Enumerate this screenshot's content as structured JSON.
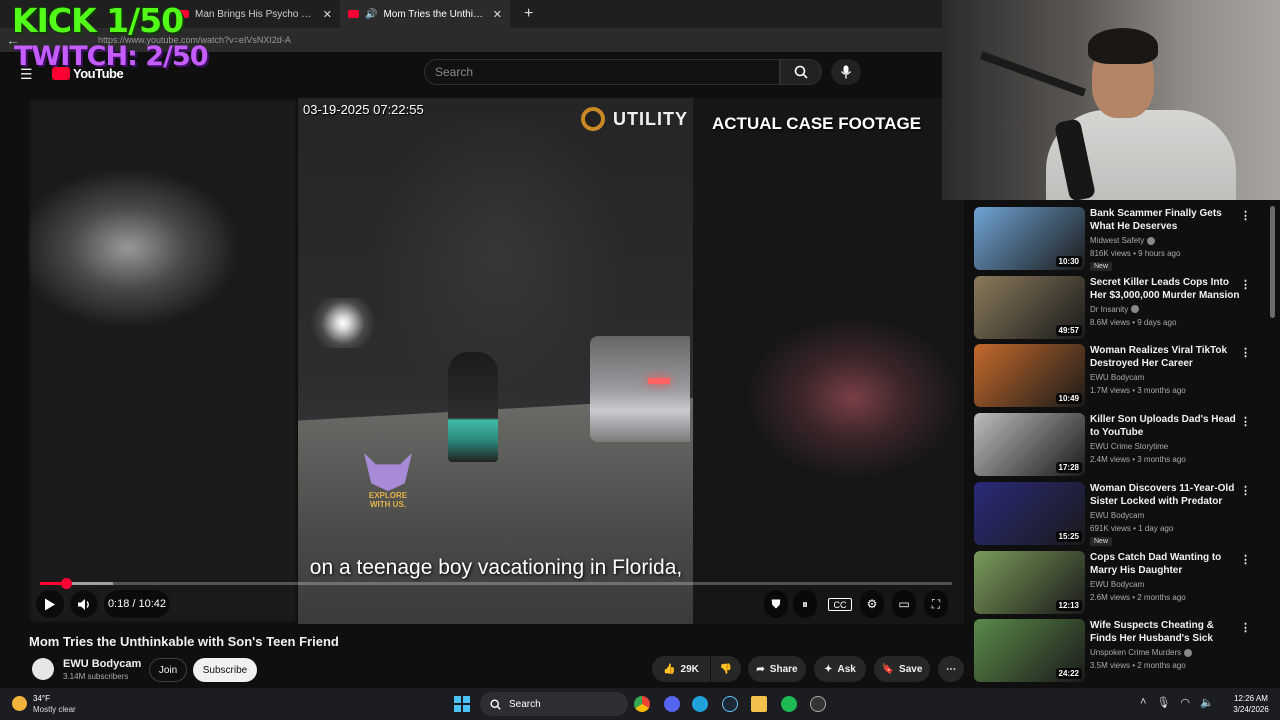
{
  "browser": {
    "tabs": [
      {
        "label": "",
        "active": false
      },
      {
        "label": "Man Brings His Psycho Girlfriend",
        "active": false
      },
      {
        "label": "Mom Tries the Unthinkable w",
        "active": true
      }
    ],
    "url": "https://www.youtube.com/watch?v=eIVsNXI2d-A"
  },
  "overlay": {
    "kick": "KICK 1/50",
    "twitch": "TWITCH: 2/50"
  },
  "youtube": {
    "logo_text": "YouTube",
    "search_placeholder": "Search"
  },
  "player": {
    "timestamp": "03-19-2025 07:22:55",
    "watermark": "UTILITY",
    "banner": "ACTUAL CASE FOOTAGE",
    "badge_text": "EXPLORE WITH US.",
    "caption": "on a teenage boy vacationing in Florida,",
    "time_display": "0:18 / 10:42",
    "progress_fraction": 0.028,
    "buffered_fraction": 0.08
  },
  "video": {
    "title": "Mom Tries the Unthinkable with Son's Teen Friend",
    "channel": "EWU Bodycam",
    "subscribers": "3.14M subscribers",
    "join_label": "Join",
    "subscribe_label": "Subscribe",
    "likes": "29K",
    "share_label": "Share",
    "ask_label": "Ask",
    "save_label": "Save"
  },
  "recommendations": [
    {
      "title": "Bank Scammer Finally Gets What He Deserves",
      "channel": "Midwest Safety",
      "verified": true,
      "meta": "816K views • 9 hours ago",
      "badge": "New",
      "duration": "10:30",
      "thumb_color": "#6fa4d4"
    },
    {
      "title": "Secret Killer Leads Cops Into Her $3,000,000 Murder Mansion",
      "channel": "Dr Insanity",
      "verified": true,
      "meta": "8.6M views • 9 days ago",
      "badge": "",
      "duration": "49:57",
      "thumb_color": "#8a7a5c"
    },
    {
      "title": "Woman Realizes Viral TikTok Destroyed Her Career",
      "channel": "EWU Bodycam",
      "verified": false,
      "meta": "1.7M views • 3 months ago",
      "badge": "",
      "duration": "10:49",
      "thumb_color": "#c46a2c"
    },
    {
      "title": "Killer Son Uploads Dad's Head to YouTube",
      "channel": "EWU Crime Storytime",
      "verified": false,
      "meta": "2.4M views • 3 months ago",
      "badge": "",
      "duration": "17:28",
      "thumb_color": "#bdbdbd"
    },
    {
      "title": "Woman Discovers 11-Year-Old Sister Locked with Predator",
      "channel": "EWU Bodycam",
      "verified": false,
      "meta": "691K views • 1 day ago",
      "badge": "New",
      "duration": "15:25",
      "thumb_color": "#2a2a7a"
    },
    {
      "title": "Cops Catch Dad Wanting to Marry His Daughter",
      "channel": "EWU Bodycam",
      "verified": false,
      "meta": "2.6M views • 2 months ago",
      "badge": "",
      "duration": "12:13",
      "thumb_color": "#7a9c5a"
    },
    {
      "title": "Wife Suspects Cheating & Finds Her Husband's Sick Secret ...",
      "channel": "Unspoken Crime Murders",
      "verified": true,
      "meta": "3.5M views • 2 months ago",
      "badge": "",
      "duration": "24:22",
      "thumb_color": "#5c8a4a"
    }
  ],
  "taskbar": {
    "temperature": "34°F",
    "condition": "Mostly clear",
    "search_label": "Search",
    "time": "12:26 AM",
    "date": "3/24/2026"
  }
}
